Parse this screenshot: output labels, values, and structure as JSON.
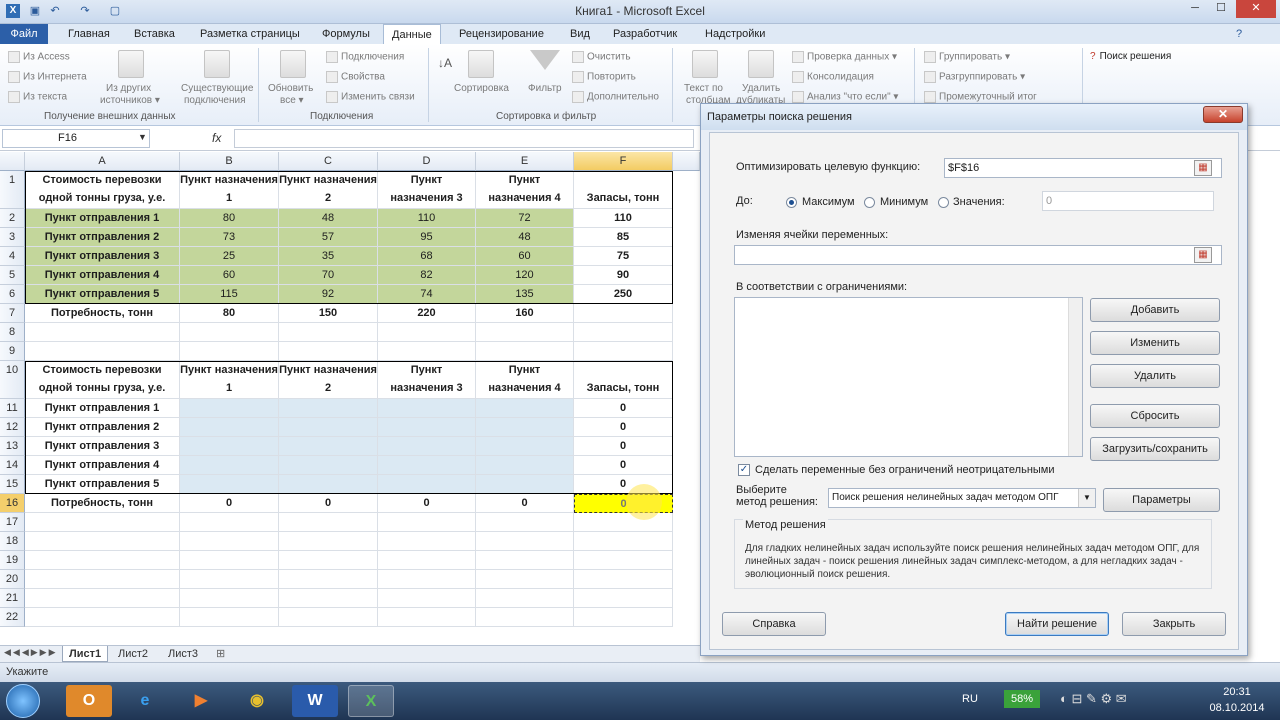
{
  "window": {
    "title": "Книга1  -  Microsoft Excel"
  },
  "ribbon_tabs": [
    "Файл",
    "Главная",
    "Вставка",
    "Разметка страницы",
    "Формулы",
    "Данные",
    "Рецензирование",
    "Вид",
    "Разработчик",
    "Надстройки"
  ],
  "ribbon": {
    "from_access": "Из Access",
    "from_web": "Из Интернета",
    "from_text": "Из текста",
    "from_other_1": "Из других",
    "from_other_2": "источников ▾",
    "existing_1": "Существующие",
    "existing_2": "подключения",
    "group_external": "Получение внешних данных",
    "refresh_1": "Обновить",
    "refresh_2": "все ▾",
    "connections": "Подключения",
    "properties": "Свойства",
    "edit_links": "Изменить связи",
    "group_connections": "Подключения",
    "sort": "Сортировка",
    "filter": "Фильтр",
    "clear": "Очистить",
    "reapply": "Повторить",
    "advanced": "Дополнительно",
    "group_sort": "Сортировка и фильтр",
    "text_to_cols_1": "Текст по",
    "text_to_cols_2": "столбцам",
    "remove_dup_1": "Удалить",
    "remove_dup_2": "дубликаты",
    "validation": "Проверка данных ▾",
    "consolidation": "Консолидация",
    "whatif": "Анализ \"что если\" ▾",
    "group": "Группировать ▾",
    "ungroup": "Разгруппировать ▾",
    "subtotal": "Промежуточный итог",
    "solver": "Поиск решения"
  },
  "formula_bar": {
    "name_box": "F16",
    "fx": "fx"
  },
  "columns": [
    "A",
    "B",
    "C",
    "D",
    "E",
    "F"
  ],
  "rows": [
    "1",
    "2",
    "3",
    "4",
    "5",
    "6",
    "7",
    "8",
    "9",
    "10",
    "11",
    "12",
    "13",
    "14",
    "15",
    "16",
    "17",
    "18",
    "19",
    "20",
    "21",
    "22"
  ],
  "table1": {
    "corner": "Стоимость перевозки одной тонны груза, у.е.",
    "headers": [
      "Пункт назначения 1",
      "Пункт назначения 2",
      "Пункт назначения 3",
      "Пункт назначения 4",
      "Запасы, тонн"
    ],
    "rows": [
      {
        "label": "Пункт отправления 1",
        "values": [
          "80",
          "48",
          "110",
          "72",
          "110"
        ]
      },
      {
        "label": "Пункт отправления 2",
        "values": [
          "73",
          "57",
          "95",
          "48",
          "85"
        ]
      },
      {
        "label": "Пункт отправления 3",
        "values": [
          "25",
          "35",
          "68",
          "60",
          "75"
        ]
      },
      {
        "label": "Пункт отправления 4",
        "values": [
          "60",
          "70",
          "82",
          "120",
          "90"
        ]
      },
      {
        "label": "Пункт отправления 5",
        "values": [
          "115",
          "92",
          "74",
          "135",
          "250"
        ]
      }
    ],
    "demand": {
      "label": "Потребность, тонн",
      "values": [
        "80",
        "150",
        "220",
        "160",
        ""
      ]
    }
  },
  "table2": {
    "corner": "Стоимость перевозки одной тонны груза, у.е.",
    "headers": [
      "Пункт назначения 1",
      "Пункт назначения 2",
      "Пункт назначения 3",
      "Пункт назначения 4",
      "Запасы, тонн"
    ],
    "rows": [
      {
        "label": "Пункт отправления 1",
        "values": [
          "",
          "",
          "",
          "",
          "0"
        ]
      },
      {
        "label": "Пункт отправления 2",
        "values": [
          "",
          "",
          "",
          "",
          "0"
        ]
      },
      {
        "label": "Пункт отправления 3",
        "values": [
          "",
          "",
          "",
          "",
          "0"
        ]
      },
      {
        "label": "Пункт отправления 4",
        "values": [
          "",
          "",
          "",
          "",
          "0"
        ]
      },
      {
        "label": "Пункт отправления 5",
        "values": [
          "",
          "",
          "",
          "",
          "0"
        ]
      }
    ],
    "demand": {
      "label": "Потребность, тонн",
      "values": [
        "0",
        "0",
        "0",
        "0",
        "0"
      ]
    }
  },
  "sheets": [
    "Лист1",
    "Лист2",
    "Лист3"
  ],
  "status": {
    "mode": "Укажите"
  },
  "dialog": {
    "title": "Параметры поиска решения",
    "close": "✕",
    "objective_label": "Оптимизировать целевую функцию:",
    "objective_value": "$F$16",
    "to_label": "До:",
    "opt_max": "Максимум",
    "opt_min": "Минимум",
    "opt_value": "Значения:",
    "value_input": "0",
    "changing_label": "Изменяя ячейки переменных:",
    "constraints_label": "В соответствии с ограничениями:",
    "btn_add": "Добавить",
    "btn_change": "Изменить",
    "btn_delete": "Удалить",
    "btn_reset": "Сбросить",
    "btn_load_save": "Загрузить/сохранить",
    "nonneg_label": "Сделать переменные без ограничений неотрицательными",
    "method_label_1": "Выберите",
    "method_label_2": "метод решения:",
    "method_value": "Поиск решения нелинейных задач методом ОПГ",
    "btn_options": "Параметры",
    "method_group": "Метод решения",
    "method_desc": "Для гладких нелинейных задач используйте поиск решения нелинейных задач методом ОПГ, для линейных задач - поиск решения линейных задач симплекс-методом, а для негладких задач - эволюционный поиск решения.",
    "btn_help": "Справка",
    "btn_solve": "Найти решение",
    "btn_close": "Закрыть"
  },
  "taskbar": {
    "lang": "RU",
    "battery": "58%",
    "time": "20:31",
    "date": "08.10.2014",
    "apps": [
      "O",
      "e",
      "▶",
      "◉",
      "W",
      "X"
    ]
  }
}
